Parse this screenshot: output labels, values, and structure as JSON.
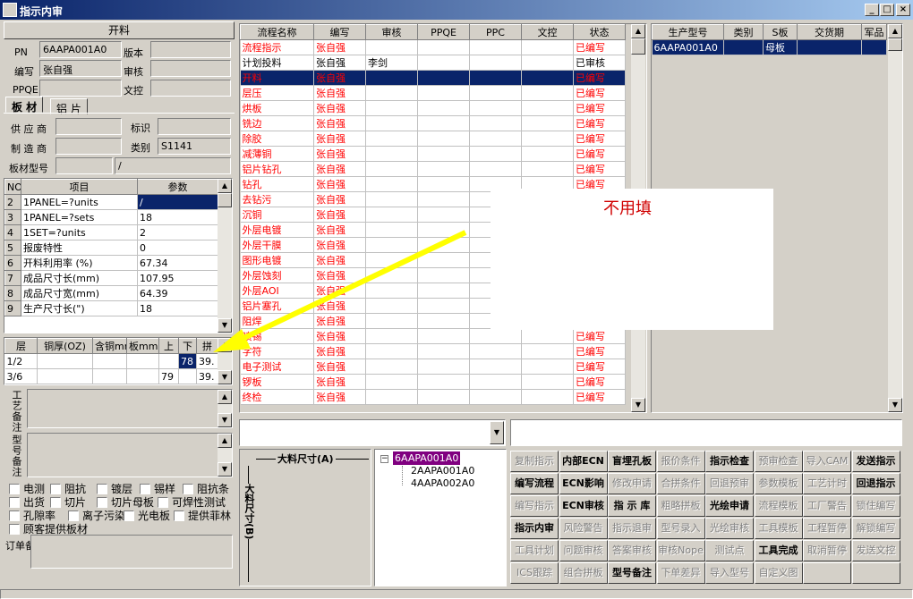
{
  "window": {
    "title": "指示内审"
  },
  "titlebar_buttons": {
    "min": "_",
    "max": "□",
    "close": "×"
  },
  "left": {
    "section_title": "开料",
    "labels": {
      "pn": "PN",
      "version": "版本",
      "editor": "编写",
      "review": "审核",
      "ppqe": "PPQE",
      "doc_ctrl": "文控",
      "supplier": "供 应 商",
      "mark": "标识",
      "maker": "制 造 商",
      "category": "类别",
      "board_model": "板材型号"
    },
    "values": {
      "pn": "6AAPA001A0",
      "version": "",
      "editor": "张自强",
      "review": "",
      "ppqe": "",
      "doc_ctrl": "",
      "supplier": "",
      "mark": "",
      "maker": "",
      "category": "S1141",
      "board_model_a": "",
      "board_model_b": "/"
    },
    "tabs": [
      "板 材",
      "铝 片"
    ],
    "params": {
      "headers": [
        "NO",
        "项目",
        "参数"
      ],
      "rows": [
        {
          "no": "2",
          "item": "1PANEL=?units",
          "val": "/"
        },
        {
          "no": "3",
          "item": "1PANEL=?sets",
          "val": "18"
        },
        {
          "no": "4",
          "item": "1SET=?units",
          "val": "2"
        },
        {
          "no": "5",
          "item": "报废特性",
          "val": "0"
        },
        {
          "no": "6",
          "item": "开料利用率 (%)",
          "val": "67.34"
        },
        {
          "no": "7",
          "item": "成品尺寸长(mm)",
          "val": "107.95"
        },
        {
          "no": "8",
          "item": "成品尺寸宽(mm)",
          "val": "64.39"
        },
        {
          "no": "9",
          "item": "生产尺寸长(\")",
          "val": "18"
        }
      ]
    },
    "layers": {
      "headers": [
        "层",
        "铜厚(OZ)",
        "含铜mm",
        "板mm",
        "上",
        "下",
        "拼"
      ],
      "rows": [
        {
          "layer": "1/2",
          "cu": "",
          "cumm": "",
          "bmm": "",
          "up": "",
          "down": "78",
          "pin": "39."
        },
        {
          "layer": "3/6",
          "cu": "",
          "cumm": "",
          "bmm": "",
          "up": "79",
          "down": "",
          "pin": "39."
        }
      ]
    },
    "process_note_label": "工艺备注",
    "type_note_label": "型号备注",
    "checkboxes": [
      [
        "电测",
        "阻抗",
        "镀层",
        "锡样",
        "阻抗条"
      ],
      [
        "出货",
        "切片",
        "切片母板",
        "可焊性测试"
      ],
      [
        "孔隙率",
        "离子污染",
        "光电板",
        "提供菲林"
      ],
      [
        "顾客提供板材"
      ]
    ],
    "order_note_label": "订单备注"
  },
  "flow": {
    "headers": [
      "流程名称",
      "编写",
      "审核",
      "PPQE",
      "PPC",
      "文控",
      "状态"
    ],
    "rows": [
      {
        "name": "流程指示",
        "editor": "张自强",
        "review": "",
        "status": "已编写",
        "red": true
      },
      {
        "name": "计划投料",
        "editor": "张自强",
        "review": "李剑",
        "status": "已审核",
        "red": false
      },
      {
        "name": "开料",
        "editor": "张自强",
        "review": "",
        "status": "已编写",
        "red": true,
        "sel": true
      },
      {
        "name": "层压",
        "editor": "张自强",
        "review": "",
        "status": "已编写",
        "red": true
      },
      {
        "name": "烘板",
        "editor": "张自强",
        "review": "",
        "status": "已编写",
        "red": true
      },
      {
        "name": "铣边",
        "editor": "张自强",
        "review": "",
        "status": "已编写",
        "red": true
      },
      {
        "name": "除胶",
        "editor": "张自强",
        "review": "",
        "status": "已编写",
        "red": true
      },
      {
        "name": "减薄铜",
        "editor": "张自强",
        "review": "",
        "status": "已编写",
        "red": true
      },
      {
        "name": "铝片钻孔",
        "editor": "张自强",
        "review": "",
        "status": "已编写",
        "red": true
      },
      {
        "name": "钻孔",
        "editor": "张自强",
        "review": "",
        "status": "已编写",
        "red": true
      },
      {
        "name": "去钻污",
        "editor": "张自强",
        "review": "",
        "status": "",
        "red": true
      },
      {
        "name": "沉铜",
        "editor": "张自强",
        "review": "",
        "status": "",
        "red": true
      },
      {
        "name": "外层电镀",
        "editor": "张自强",
        "review": "",
        "status": "",
        "red": true
      },
      {
        "name": "外层干膜",
        "editor": "张自强",
        "review": "",
        "status": "",
        "red": true
      },
      {
        "name": "图形电镀",
        "editor": "张自强",
        "review": "",
        "status": "",
        "red": true
      },
      {
        "name": "外层蚀刻",
        "editor": "张自强",
        "review": "",
        "status": "",
        "red": true
      },
      {
        "name": "外层AOI",
        "editor": "张自强",
        "review": "",
        "status": "",
        "red": true
      },
      {
        "name": "铝片塞孔",
        "editor": "张自强",
        "review": "",
        "status": "",
        "red": true
      },
      {
        "name": "阻焊",
        "editor": "张自强",
        "review": "",
        "status": "",
        "red": true
      },
      {
        "name": "喷锡",
        "editor": "张自强",
        "review": "",
        "status": "已编写",
        "red": true
      },
      {
        "name": "字符",
        "editor": "张自强",
        "review": "",
        "status": "已编写",
        "red": true
      },
      {
        "name": "电子测试",
        "editor": "张自强",
        "review": "",
        "status": "已编写",
        "red": true
      },
      {
        "name": "锣板",
        "editor": "张自强",
        "review": "",
        "status": "已编写",
        "red": true
      },
      {
        "name": "终检",
        "editor": "张自强",
        "review": "",
        "status": "已编写",
        "red": true
      }
    ]
  },
  "right_table": {
    "headers": [
      "生产型号",
      "类别",
      "S板",
      "交货期",
      "军品"
    ],
    "rows": [
      {
        "model": "6AAPA001A0",
        "cat": "",
        "s": "母板",
        "due": "",
        "mil": ""
      }
    ]
  },
  "overlay": {
    "note": "不用填"
  },
  "panel": {
    "width_label": "大料尺寸(A)",
    "height_label": "大料尺寸(B)"
  },
  "tree": {
    "root": "6AAPA001A0",
    "children": [
      "2AAPA001A0",
      "4AAPA002A0"
    ]
  },
  "buttons": [
    [
      [
        "复制指示",
        true
      ],
      [
        "内部ECN",
        false
      ],
      [
        "盲埋孔板",
        false
      ],
      [
        "报价条件",
        true
      ],
      [
        "指示检查",
        false
      ],
      [
        "预审检查",
        true
      ],
      [
        "导入CAM",
        true
      ],
      [
        "发送指示",
        false
      ]
    ],
    [
      [
        "编写流程",
        false
      ],
      [
        "ECN影响",
        false
      ],
      [
        "修改申请",
        true
      ],
      [
        "合拼条件",
        true
      ],
      [
        "回退预审",
        true
      ],
      [
        "参数模板",
        true
      ],
      [
        "工艺计时",
        true
      ],
      [
        "回退指示",
        false
      ]
    ],
    [
      [
        "编写指示",
        true
      ],
      [
        "ECN审核",
        false
      ],
      [
        "指 示 库",
        false
      ],
      [
        "粗略拼板",
        true
      ],
      [
        "光绘申请",
        false
      ],
      [
        "流程模板",
        true
      ],
      [
        "工厂警告",
        true
      ],
      [
        "锁住编写",
        true
      ]
    ],
    [
      [
        "指示内审",
        false
      ],
      [
        "风险警告",
        true
      ],
      [
        "指示退审",
        true
      ],
      [
        "型号录入",
        true
      ],
      [
        "光绘审核",
        true
      ],
      [
        "工具模板",
        true
      ],
      [
        "工程暂停",
        true
      ],
      [
        "解锁编写",
        true
      ]
    ],
    [
      [
        "工具计划",
        true
      ],
      [
        "问题审核",
        true
      ],
      [
        "答案审核",
        true
      ],
      [
        "审核Nope",
        true
      ],
      [
        "测试点",
        true
      ],
      [
        "工具完成",
        false
      ],
      [
        "取消暂停",
        true
      ],
      [
        "发送文控",
        true
      ]
    ],
    [
      [
        "ICS跟踪",
        true
      ],
      [
        "组合拼板",
        true
      ],
      [
        "型号备注",
        false
      ],
      [
        "下单差异",
        true
      ],
      [
        "导入型号",
        true
      ],
      [
        "自定义图",
        true
      ],
      [
        "",
        true
      ],
      [
        "",
        true
      ]
    ]
  ],
  "colors": {
    "accent": "#0a246a",
    "status_red": "#ff0000",
    "arrow": "#ffff00",
    "tree_sel": "#800080"
  }
}
